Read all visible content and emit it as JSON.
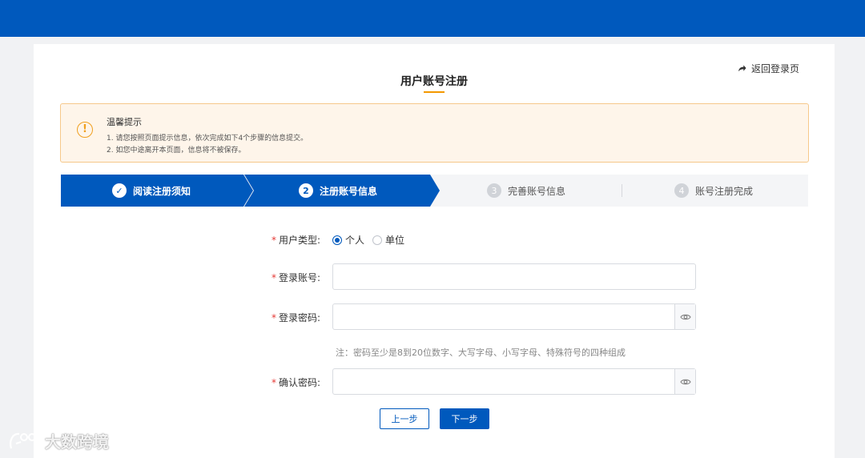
{
  "header": {
    "back_label": "返回登录页",
    "title": "用户账号注册"
  },
  "notice": {
    "title": "温馨提示",
    "lines": [
      "1. 请您按照页面提示信息，依次完成如下4个步骤的信息提交。",
      "2. 如您中途离开本页面，信息将不被保存。"
    ]
  },
  "steps": [
    {
      "number": "✓",
      "label": "阅读注册须知",
      "state": "done"
    },
    {
      "number": "2",
      "label": "注册账号信息",
      "state": "current"
    },
    {
      "number": "3",
      "label": "完善账号信息",
      "state": "pending"
    },
    {
      "number": "4",
      "label": "账号注册完成",
      "state": "pending"
    }
  ],
  "form": {
    "required_mark": "*",
    "user_type": {
      "label": "用户类型:",
      "options": [
        "个人",
        "单位"
      ],
      "selected": "个人"
    },
    "account": {
      "label": "登录账号:",
      "value": "",
      "placeholder": ""
    },
    "password": {
      "label": "登录密码:",
      "value": "",
      "placeholder": ""
    },
    "password_hint": "注：密码至少是8到20位数字、大写字母、小写字母、特殊符号的四种组成",
    "confirm_password": {
      "label": "确认密码:",
      "value": "",
      "placeholder": ""
    }
  },
  "buttons": {
    "prev": "上一步",
    "next": "下一步"
  },
  "watermark": {
    "text": "大数跨境"
  },
  "colors": {
    "primary": "#0059bd",
    "accent": "#f39800",
    "notice_bg": "#fef5ea",
    "required": "#e53935"
  },
  "icons": [
    "share-arrow-icon",
    "exclamation-circle-icon",
    "check-icon",
    "eye-icon"
  ]
}
